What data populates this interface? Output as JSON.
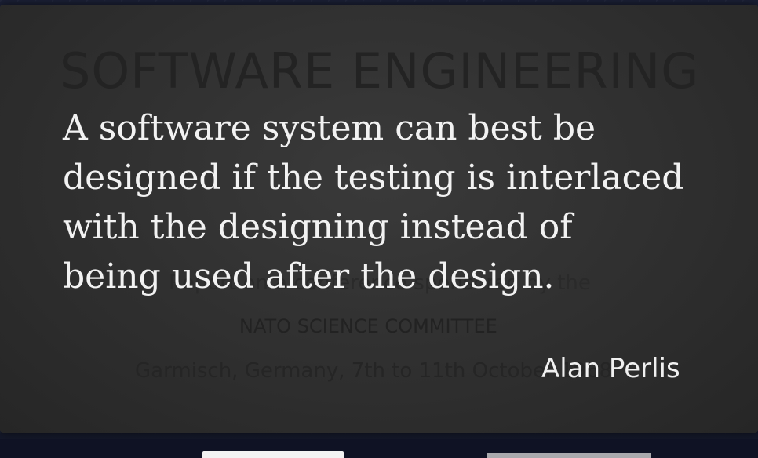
{
  "slide": {
    "background_document": {
      "title": "SOFTWARE ENGINEERING",
      "report_line": "Report on a conference sponsored by the",
      "committee": "NATO SCIENCE COMMITTEE",
      "location_date": "Garmisch, Germany, 7th to 11th October 1968"
    },
    "quote": {
      "lines": [
        "A software system can best be",
        "designed if the testing is interlaced",
        "with the designing instead of",
        "being used after the design."
      ]
    },
    "attribution": "Alan Perlis"
  },
  "colors": {
    "slide_background": "#2f2f2f",
    "quote_text": "#f2f2f2",
    "page_background": "#161a2e"
  }
}
